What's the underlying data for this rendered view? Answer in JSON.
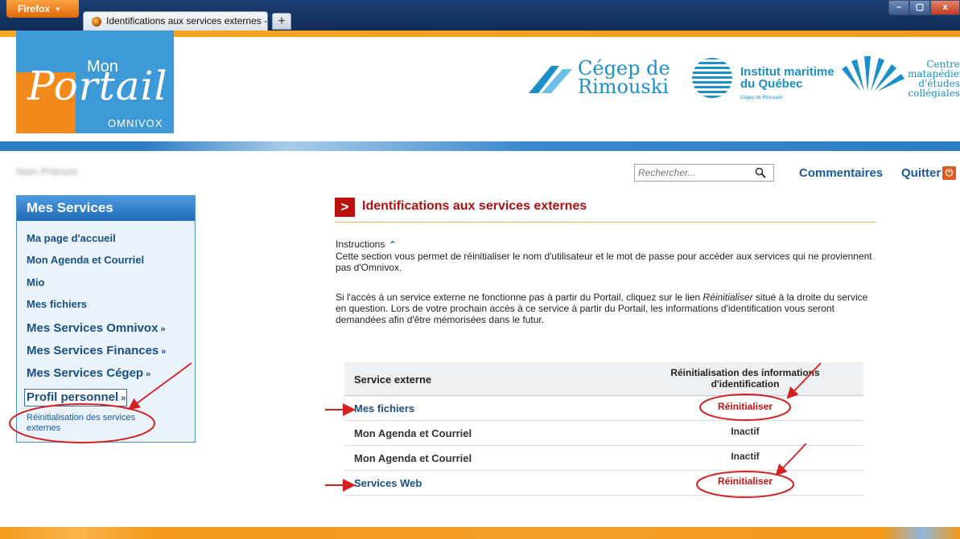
{
  "browser": {
    "menu_label": "Firefox",
    "tab_title": "Identifications aux services externes - O...",
    "new_tab": "+",
    "min": "–",
    "max": "▢",
    "close": "x"
  },
  "logo": {
    "mon": "Mon",
    "portail": "Portail",
    "omnivox": "OMNIVOX"
  },
  "partners": {
    "cegep_line1": "Cégep de",
    "cegep_line2": "Rimouski",
    "imq_line1": "Institut maritime",
    "imq_line2": "du Québec",
    "imq_sub": "Cégep de Rimouski",
    "cmec_line1": "Centre",
    "cmec_line2": "matapédien",
    "cmec_line3": "d'études",
    "cmec_line4": "collégiales"
  },
  "topbar": {
    "username": "Nom Prénom",
    "search_placeholder": "Rechercher...",
    "comments": "Commentaires",
    "quit": "Quitter"
  },
  "sidebar": {
    "title": "Mes Services",
    "items": [
      {
        "label": "Ma page d'accueil"
      },
      {
        "label": "Mon Agenda et Courriel"
      },
      {
        "label": "Mio"
      },
      {
        "label": "Mes fichiers"
      },
      {
        "label": "Mes Services Omnivox"
      },
      {
        "label": "Mes Services Finances"
      },
      {
        "label": "Mes Services Cégep"
      },
      {
        "label": "Profil personnel"
      }
    ],
    "expand_glyph": "»",
    "sub_item": "Réinitialisation des services externes"
  },
  "main": {
    "title": "Identifications aux services externes",
    "instructions_label": "Instructions",
    "instructions_toggle": "⌃",
    "para1": "Cette section vous permet de réinitialiser le nom d'utilisateur et le mot de passe pour accéder aux services qui ne proviennent pas d'Omnivox.",
    "para2_a": "Si l'accès à un service externe ne fonctionne pas à partir du Portail, cliquez sur le lien ",
    "para2_em": "Réinitialiser",
    "para2_b": " situé à la droite du service en question. Lors de votre prochain accès à ce service à partir du Portail, les informations d'identification vous seront demandées afin d'être mémorisées dans le futur.",
    "table": {
      "col1": "Service externe",
      "col2": "Réinitialisation des informations d'identification",
      "rows": [
        {
          "service": "Mes fichiers",
          "status": "Réinitialiser"
        },
        {
          "service": "Mon Agenda et Courriel",
          "status": "Inactif"
        },
        {
          "service": "Mon Agenda et Courriel",
          "status": "Inactif"
        },
        {
          "service": "Services Web",
          "status": "Réinitialiser"
        }
      ]
    }
  },
  "colors": {
    "accent_orange": "#f39a1c",
    "portal_blue": "#2e7dc4",
    "link_blue": "#1a4f86",
    "heading_red": "#b30f0f",
    "reset_red": "#c81414"
  },
  "icons": {
    "search": "search-icon",
    "quit": "power-icon",
    "heading": "chevron-right-icon"
  }
}
